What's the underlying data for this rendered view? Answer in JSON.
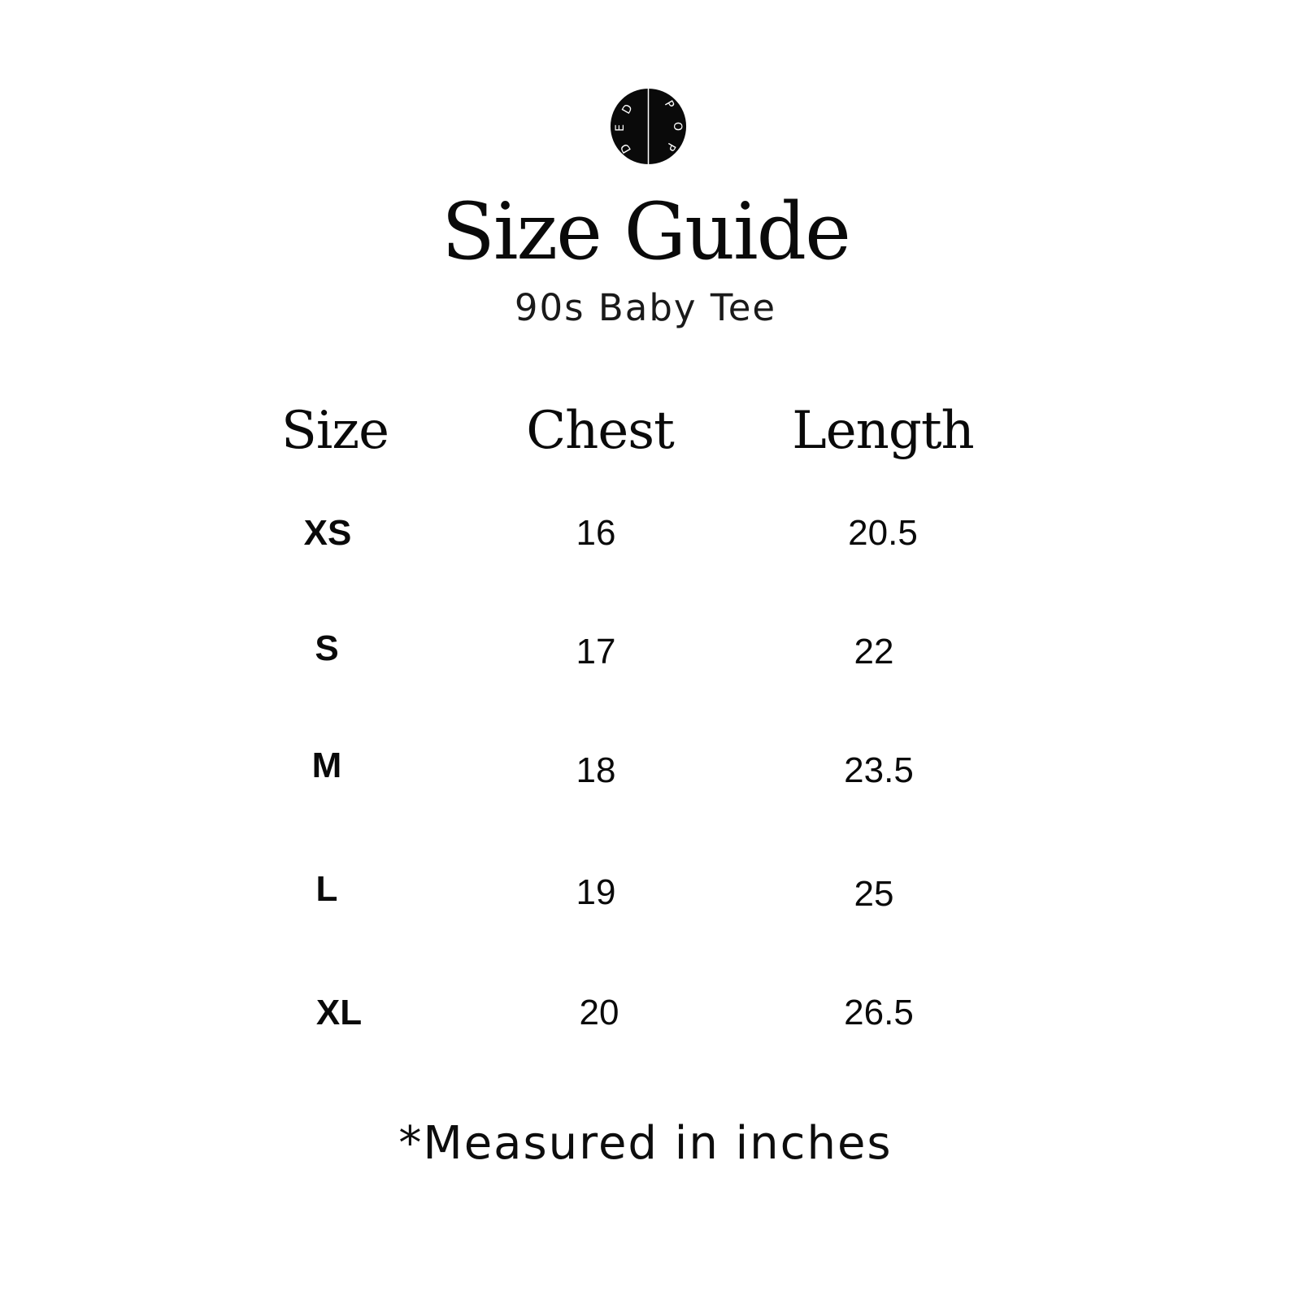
{
  "logo": {
    "letters_left": "DED",
    "letters_right": "POP"
  },
  "header": {
    "title": "Size Guide",
    "subtitle": "90s Baby Tee"
  },
  "table": {
    "columns": [
      "Size",
      "Chest",
      "Length"
    ],
    "rows": [
      {
        "size": "XS",
        "chest": "16",
        "length": "20.5"
      },
      {
        "size": "S",
        "chest": "17",
        "length": "22"
      },
      {
        "size": "M",
        "chest": "18",
        "length": "23.5"
      },
      {
        "size": "L",
        "chest": "19",
        "length": "25"
      },
      {
        "size": "XL",
        "chest": "20",
        "length": "26.5"
      }
    ]
  },
  "footer": {
    "note": "*Measured in inches"
  }
}
